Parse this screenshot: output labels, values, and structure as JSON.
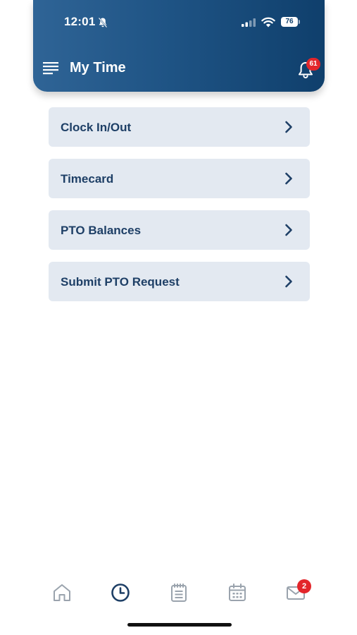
{
  "status_bar": {
    "time": "12:01",
    "battery_level": "76",
    "icons": [
      "bell-slash-icon",
      "cellular-signal-icon",
      "wifi-icon",
      "battery-icon"
    ]
  },
  "header": {
    "title": "My Time",
    "menu_icon": "hamburger-menu-icon",
    "notifications_icon": "bell-icon",
    "notifications_count": "61"
  },
  "menu_items": [
    {
      "label": "Clock In/Out",
      "icon": "chevron-right-icon"
    },
    {
      "label": "Timecard",
      "icon": "chevron-right-icon"
    },
    {
      "label": "PTO Balances",
      "icon": "chevron-right-icon"
    },
    {
      "label": "Submit PTO Request",
      "icon": "chevron-right-icon"
    }
  ],
  "tab_bar": {
    "tabs": [
      {
        "icon": "home-icon",
        "active": false
      },
      {
        "icon": "clock-icon",
        "active": true
      },
      {
        "icon": "notepad-icon",
        "active": false
      },
      {
        "icon": "calendar-icon",
        "active": false
      },
      {
        "icon": "mail-icon",
        "active": false,
        "badge": "2"
      }
    ]
  },
  "colors": {
    "header_gradient_start": "#2f6496",
    "header_gradient_end": "#0f3f6c",
    "menu_item_background": "#e3e9f1",
    "menu_text": "#1e3f66",
    "tab_active": "#1e3f66",
    "tab_inactive": "#9aa3ad",
    "badge": "#e3262b"
  }
}
